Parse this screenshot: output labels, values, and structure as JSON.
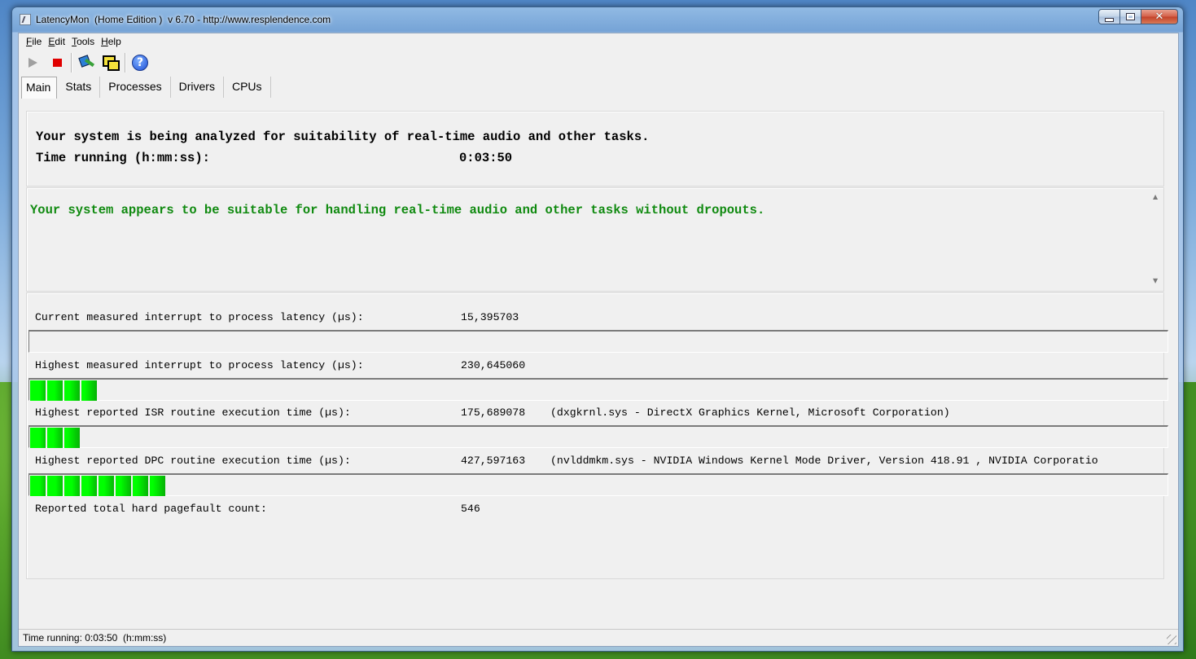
{
  "window": {
    "title": "LatencyMon  (Home Edition )  v 6.70 - http://www.resplendence.com"
  },
  "menu": [
    "File",
    "Edit",
    "Tools",
    "Help"
  ],
  "toolbar": {
    "icons": [
      "play-icon",
      "stop-icon",
      "tools-icon",
      "windows-icon",
      "help-icon"
    ]
  },
  "tabs": [
    "Main",
    "Stats",
    "Processes",
    "Drivers",
    "CPUs"
  ],
  "analysis": {
    "status_line": "Your system is being analyzed for suitability of real-time audio and other tasks.",
    "time_label": "Time running (h:mm:ss):",
    "time_value": "0:03:50"
  },
  "verdict": "Your system appears to be suitable for handling real-time audio and other tasks without dropouts.",
  "metrics": [
    {
      "label": "Current measured interrupt to process latency (µs):",
      "value": "15,395703",
      "detail": "",
      "bar_segments": 0
    },
    {
      "label": "Highest measured interrupt to process latency (µs):",
      "value": "230,645060",
      "detail": "",
      "bar_segments": 4
    },
    {
      "label": "Highest reported ISR routine execution time (µs):",
      "value": "175,689078",
      "detail": "(dxgkrnl.sys - DirectX Graphics Kernel, Microsoft Corporation)",
      "bar_segments": 3
    },
    {
      "label": "Highest reported DPC routine execution time (µs):",
      "value": "427,597163",
      "detail": "(nvlddmkm.sys - NVIDIA Windows Kernel Mode Driver, Version 418.91 , NVIDIA Corporatio",
      "bar_segments": 8
    }
  ],
  "pagefault": {
    "label": "Reported total hard pagefault count:",
    "value": "546"
  },
  "statusbar": "Time running: 0:03:50  (h:mm:ss)",
  "colors": {
    "verdict_green": "#108a10",
    "bar_green_light": "#00ff00",
    "bar_green_dark": "#0a8a0a",
    "stop_red": "#e00000"
  }
}
